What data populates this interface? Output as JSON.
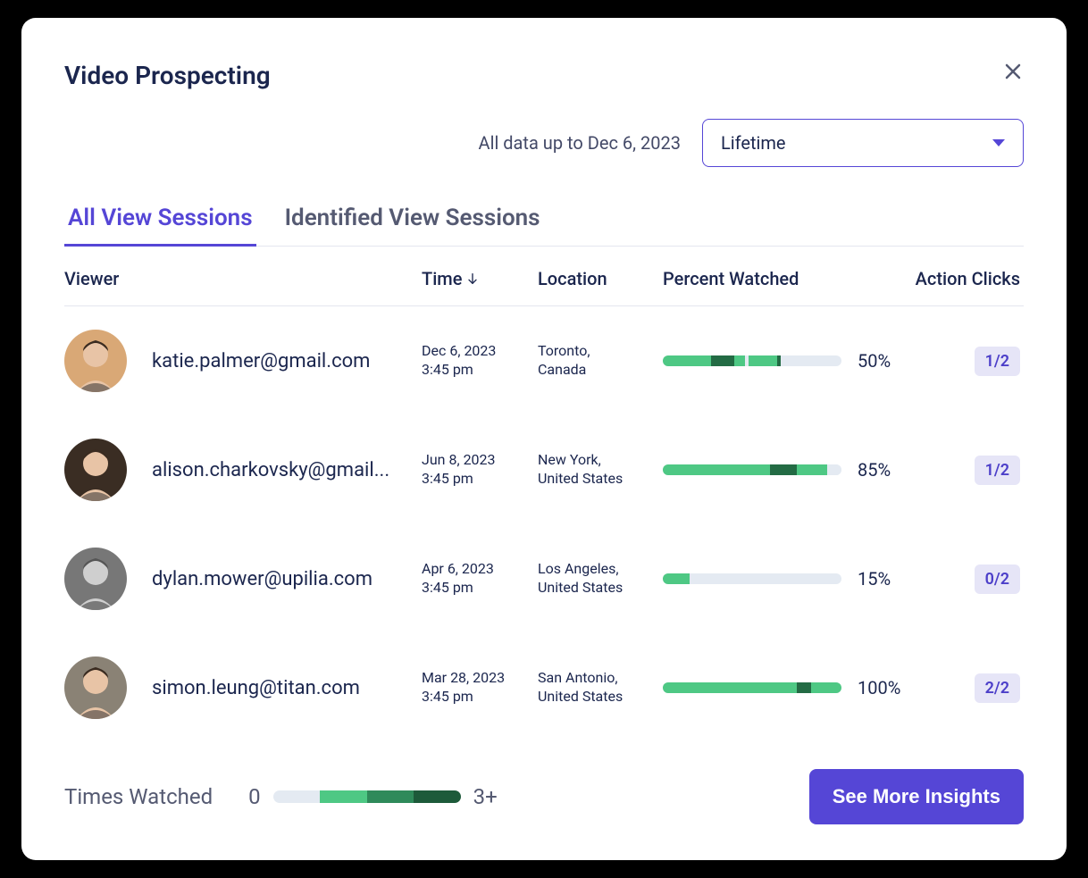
{
  "modal": {
    "title": "Video Prospecting",
    "date_range_label": "All data up to Dec 6, 2023",
    "dropdown": {
      "selected": "Lifetime"
    }
  },
  "tabs": [
    {
      "label": "All View Sessions",
      "active": true
    },
    {
      "label": "Identified View Sessions",
      "active": false
    }
  ],
  "columns": {
    "viewer": "Viewer",
    "time": "Time",
    "location": "Location",
    "percent_watched": "Percent Watched",
    "action_clicks": "Action Clicks"
  },
  "rows": [
    {
      "email": "katie.palmer@gmail.com",
      "avatar_bg": "#d9a876",
      "avatar_mode": "color",
      "date": "Dec 6, 2023",
      "time": "3:45 pm",
      "city": "Toronto,",
      "country": "Canada",
      "percent": 50,
      "percent_label": "50%",
      "segments": [
        {
          "start": 0,
          "end": 27,
          "color": "#4ec884"
        },
        {
          "start": 27,
          "end": 40,
          "color": "#236b44"
        },
        {
          "start": 40,
          "end": 46,
          "color": "#4ec884"
        },
        {
          "start": 48,
          "end": 64,
          "color": "#4ec884"
        },
        {
          "start": 64,
          "end": 66,
          "color": "#236b44"
        }
      ],
      "action_clicks": "1/2"
    },
    {
      "email": "alison.charkovsky@gmail...",
      "avatar_bg": "#3a2d23",
      "avatar_mode": "color",
      "date": "Jun 8, 2023",
      "time": "3:45 pm",
      "city": "New York,",
      "country": "United States",
      "percent": 85,
      "percent_label": "85%",
      "segments": [
        {
          "start": 0,
          "end": 60,
          "color": "#4ec884"
        },
        {
          "start": 60,
          "end": 75,
          "color": "#236b44"
        },
        {
          "start": 75,
          "end": 92,
          "color": "#4ec884"
        },
        {
          "start": 92,
          "end": 100,
          "color": "#e4eaf2"
        }
      ],
      "action_clicks": "1/2"
    },
    {
      "email": "dylan.mower@upilia.com",
      "avatar_bg": "#777",
      "avatar_mode": "bw",
      "date": "Apr 6, 2023",
      "time": "3:45 pm",
      "city": "Los Angeles,",
      "country": "United States",
      "percent": 15,
      "percent_label": "15%",
      "segments": [
        {
          "start": 0,
          "end": 15,
          "color": "#4ec884"
        }
      ],
      "action_clicks": "0/2"
    },
    {
      "email": "simon.leung@titan.com",
      "avatar_bg": "#8a8275",
      "avatar_mode": "color",
      "date": "Mar 28, 2023",
      "time": "3:45 pm",
      "city": "San Antonio,",
      "country": "United States",
      "percent": 100,
      "percent_label": "100%",
      "segments": [
        {
          "start": 0,
          "end": 75,
          "color": "#4ec884"
        },
        {
          "start": 75,
          "end": 83,
          "color": "#236b44"
        },
        {
          "start": 83,
          "end": 100,
          "color": "#4ec884"
        }
      ],
      "action_clicks": "2/2"
    }
  ],
  "legend": {
    "label": "Times Watched",
    "min": "0",
    "max": "3+",
    "colors": [
      "#e4eaf2",
      "#4ec884",
      "#2f8a5a",
      "#1d5a3a"
    ]
  },
  "cta": {
    "label": "See More Insights"
  }
}
